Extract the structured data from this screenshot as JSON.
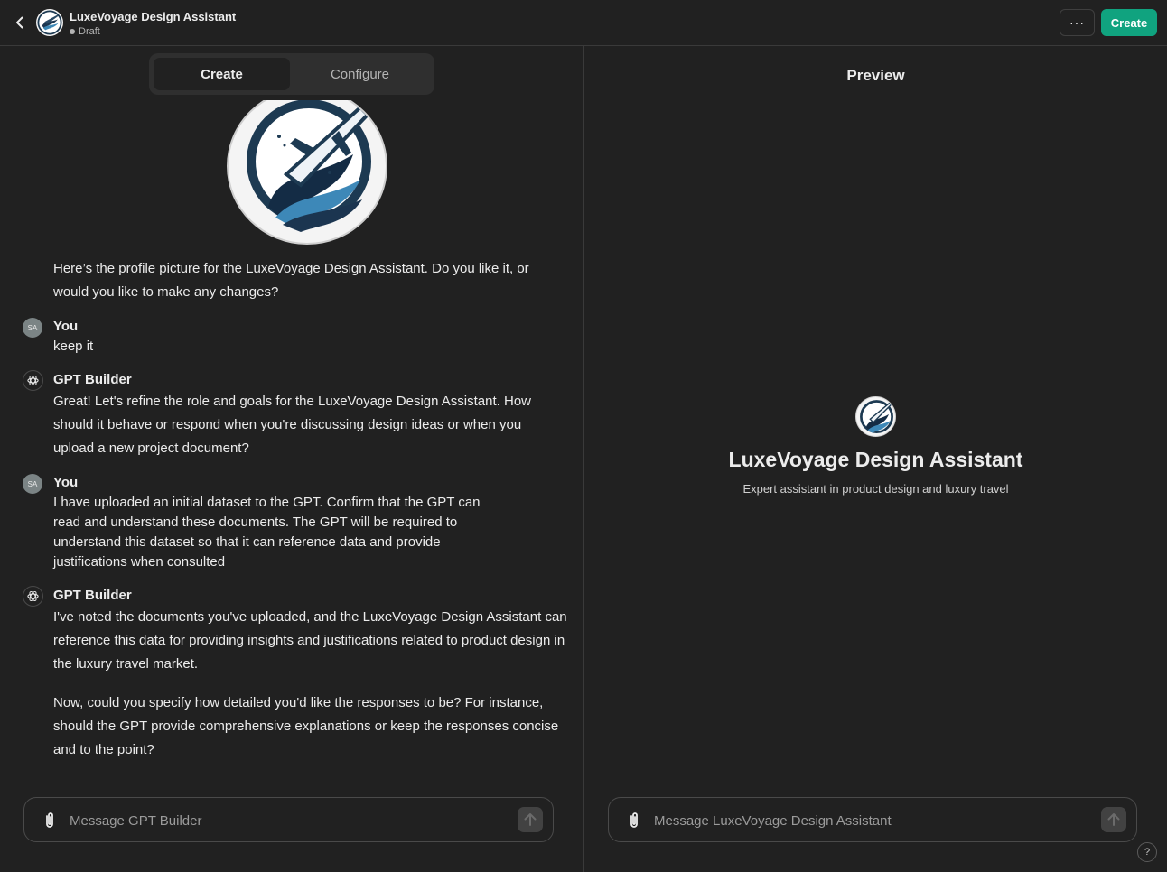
{
  "header": {
    "title": "LuxeVoyage Design Assistant",
    "status": "Draft",
    "more_label": "···",
    "create_label": "Create"
  },
  "tabs": [
    {
      "label": "Create",
      "active": true
    },
    {
      "label": "Configure",
      "active": false
    }
  ],
  "messages": [
    {
      "sender": "",
      "text": "Here’s the profile picture for the LuxeVoyage Design Assistant. Do you like it, or would you like to make any changes?"
    },
    {
      "sender": "You",
      "avatar": "SA",
      "text": "keep it"
    },
    {
      "sender": "GPT Builder",
      "text": "Great! Let's refine the role and goals for the LuxeVoyage Design Assistant. How should it behave or respond when you're discussing design ideas or when you upload a new project document?"
    },
    {
      "sender": "You",
      "avatar": "SA",
      "text": "I have uploaded an initial dataset to the GPT. Confirm that the GPT can read and understand these documents. The GPT will be required to understand this dataset so that it can reference data and provide justifications when consulted"
    },
    {
      "sender": "GPT Builder",
      "text": "I've noted the documents you've uploaded, and the LuxeVoyage Design Assistant can reference this data for providing insights and justifications related to product design in the luxury travel market.",
      "text2": "Now, could you specify how detailed you'd like the responses to be? For instance, should the GPT provide comprehensive explanations or keep the responses concise and to the point?"
    }
  ],
  "left_composer": {
    "placeholder": "Message GPT Builder"
  },
  "preview": {
    "title": "Preview",
    "name": "LuxeVoyage Design Assistant",
    "description": "Expert assistant in product design and luxury travel",
    "composer_placeholder": "Message LuxeVoyage Design Assistant"
  },
  "help_label": "?",
  "colors": {
    "accent": "#10a37f",
    "background": "#212121",
    "panel": "#2f2f2f"
  }
}
